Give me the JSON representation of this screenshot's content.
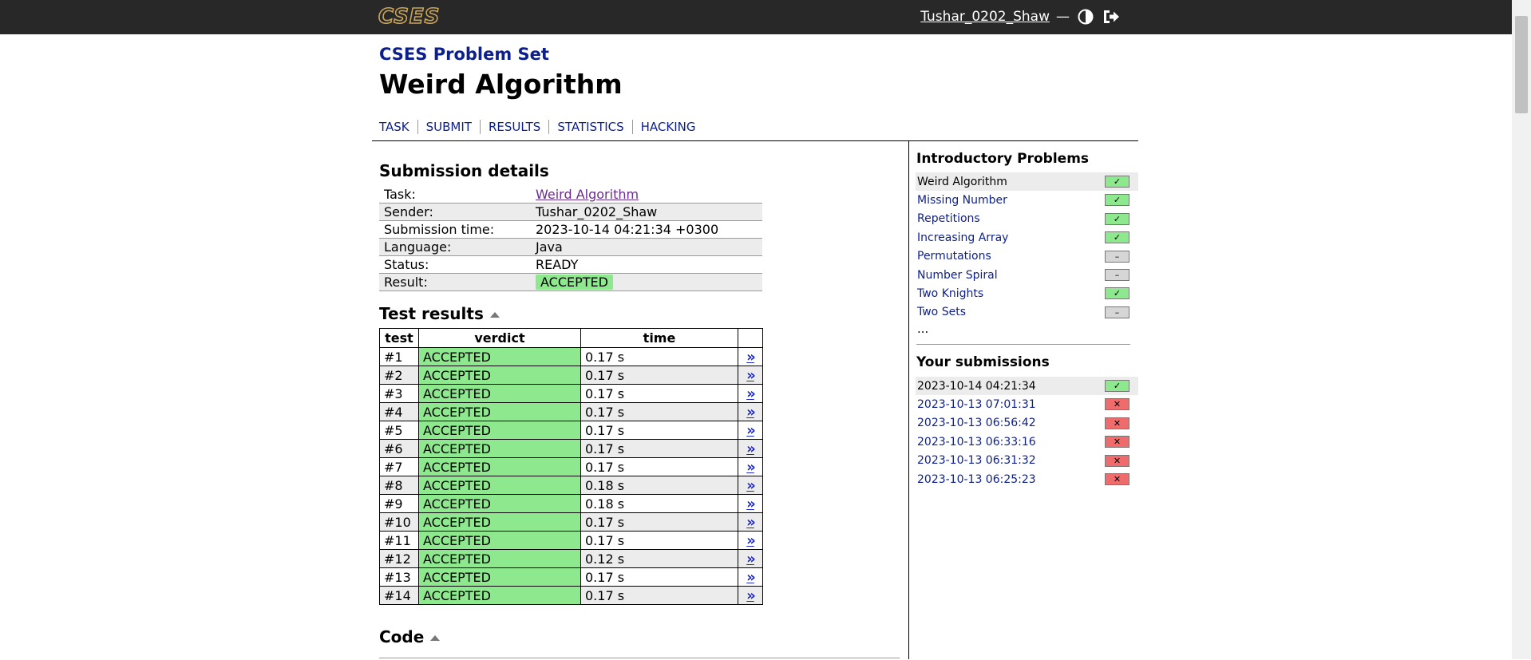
{
  "header": {
    "logo_text": "CSES",
    "username": "Tushar_0202_Shaw",
    "separator": "—",
    "theme_icon": "contrast-icon",
    "logout_icon": "logout-icon"
  },
  "page": {
    "subtitle": "CSES Problem Set",
    "title": "Weird Algorithm",
    "tabs": [
      "TASK",
      "SUBMIT",
      "RESULTS",
      "STATISTICS",
      "HACKING"
    ]
  },
  "details": {
    "heading": "Submission details",
    "rows": [
      {
        "key": "Task:",
        "value": "Weird Algorithm"
      },
      {
        "key": "Sender:",
        "value": "Tushar_0202_Shaw"
      },
      {
        "key": "Submission time:",
        "value": "2023-10-14 04:21:34 +0300"
      },
      {
        "key": "Language:",
        "value": "Java"
      },
      {
        "key": "Status:",
        "value": "READY"
      },
      {
        "key": "Result:",
        "value": "ACCEPTED"
      }
    ]
  },
  "tests": {
    "heading": "Test results",
    "columns": [
      "test",
      "verdict",
      "time"
    ],
    "link_symbol": "»",
    "rows": [
      {
        "test": "#1",
        "verdict": "ACCEPTED",
        "time": "0.17 s"
      },
      {
        "test": "#2",
        "verdict": "ACCEPTED",
        "time": "0.17 s"
      },
      {
        "test": "#3",
        "verdict": "ACCEPTED",
        "time": "0.17 s"
      },
      {
        "test": "#4",
        "verdict": "ACCEPTED",
        "time": "0.17 s"
      },
      {
        "test": "#5",
        "verdict": "ACCEPTED",
        "time": "0.17 s"
      },
      {
        "test": "#6",
        "verdict": "ACCEPTED",
        "time": "0.17 s"
      },
      {
        "test": "#7",
        "verdict": "ACCEPTED",
        "time": "0.17 s"
      },
      {
        "test": "#8",
        "verdict": "ACCEPTED",
        "time": "0.18 s"
      },
      {
        "test": "#9",
        "verdict": "ACCEPTED",
        "time": "0.18 s"
      },
      {
        "test": "#10",
        "verdict": "ACCEPTED",
        "time": "0.17 s"
      },
      {
        "test": "#11",
        "verdict": "ACCEPTED",
        "time": "0.17 s"
      },
      {
        "test": "#12",
        "verdict": "ACCEPTED",
        "time": "0.12 s"
      },
      {
        "test": "#13",
        "verdict": "ACCEPTED",
        "time": "0.17 s"
      },
      {
        "test": "#14",
        "verdict": "ACCEPTED",
        "time": "0.17 s"
      }
    ]
  },
  "code": {
    "heading": "Code"
  },
  "sidebar": {
    "problems_heading": "Introductory Problems",
    "problems": [
      {
        "name": "Weird Algorithm",
        "status": "ok"
      },
      {
        "name": "Missing Number",
        "status": "ok"
      },
      {
        "name": "Repetitions",
        "status": "ok"
      },
      {
        "name": "Increasing Array",
        "status": "ok"
      },
      {
        "name": "Permutations",
        "status": "none"
      },
      {
        "name": "Number Spiral",
        "status": "none"
      },
      {
        "name": "Two Knights",
        "status": "ok"
      },
      {
        "name": "Two Sets",
        "status": "none"
      }
    ],
    "more": "...",
    "submissions_heading": "Your submissions",
    "submissions": [
      {
        "time": "2023-10-14 04:21:34",
        "status": "ok"
      },
      {
        "time": "2023-10-13 07:01:31",
        "status": "bad"
      },
      {
        "time": "2023-10-13 06:56:42",
        "status": "bad"
      },
      {
        "time": "2023-10-13 06:33:16",
        "status": "bad"
      },
      {
        "time": "2023-10-13 06:31:32",
        "status": "bad"
      },
      {
        "time": "2023-10-13 06:25:23",
        "status": "bad"
      }
    ],
    "marks": {
      "ok": "✓",
      "none": "–",
      "bad": "✕"
    }
  },
  "colors": {
    "header_bg": "#282828",
    "link": "#0d1f8a",
    "accepted": "#8ee88e",
    "failed": "#f06b6b",
    "neutral": "#d6d6d6"
  }
}
